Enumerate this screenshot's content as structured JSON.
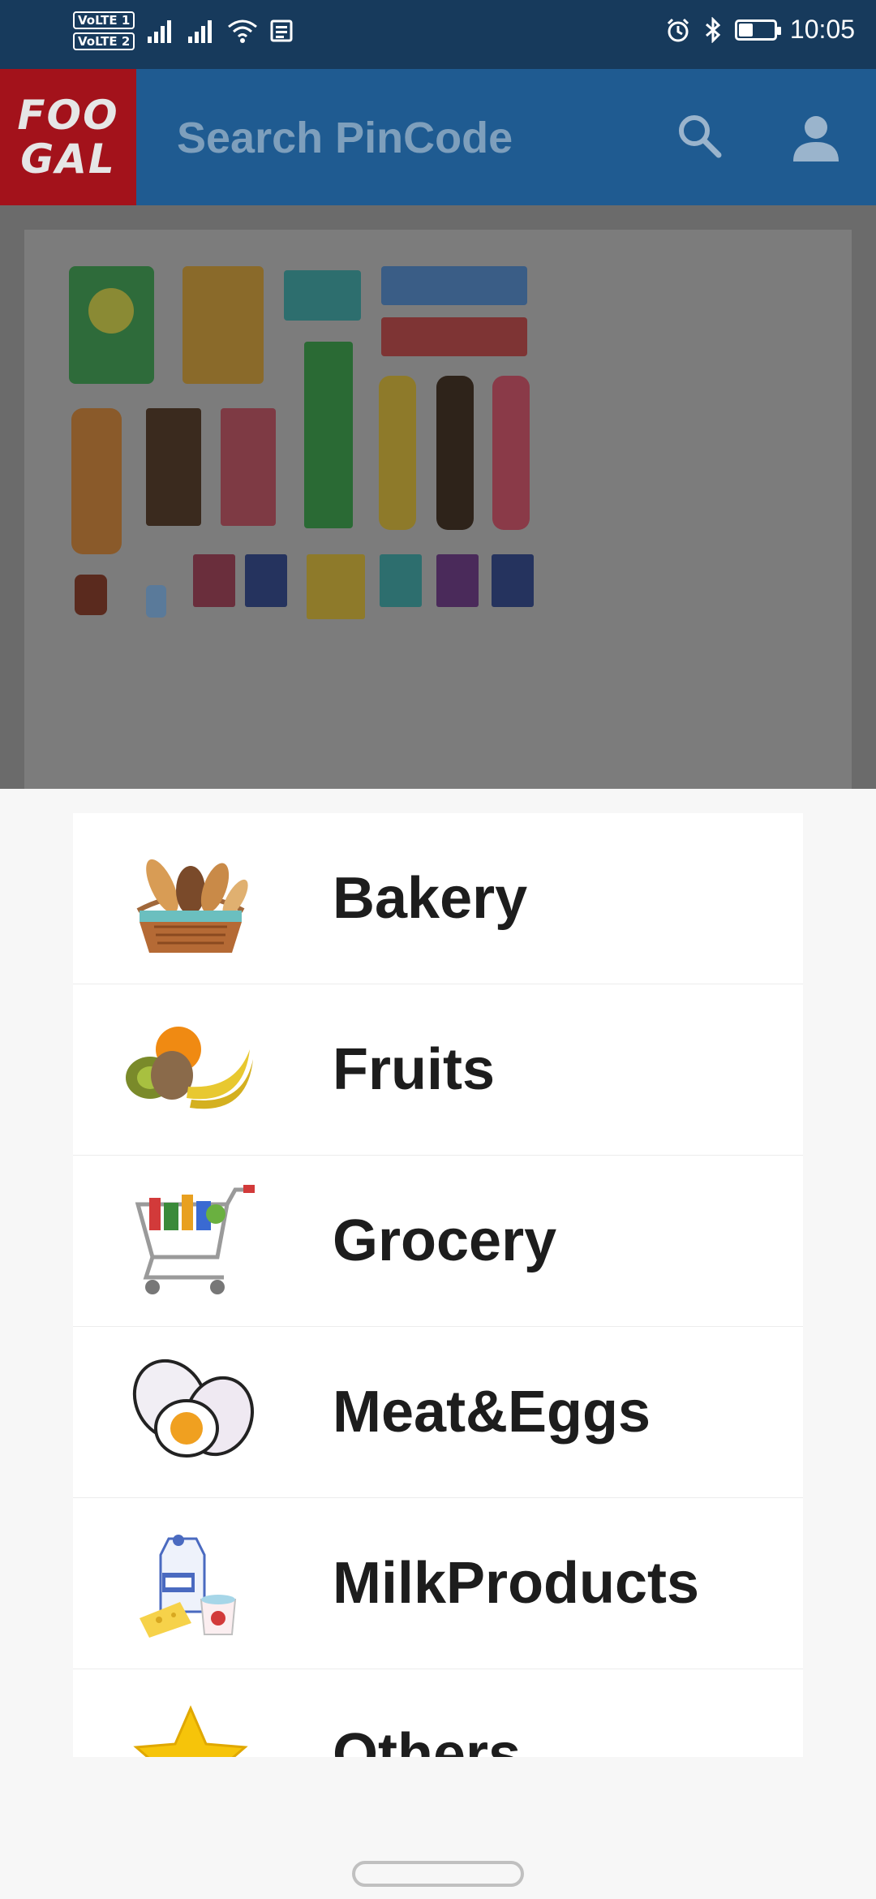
{
  "status_bar": {
    "sim1": "VoLTE 1",
    "sim2": "VoLTE 2",
    "time": "10:05",
    "battery_level": 0.4
  },
  "app_bar": {
    "logo_line1": "FOO",
    "logo_line2": "GAL",
    "search_placeholder": "Search  PinCode",
    "colors": {
      "bar": "#1f5b91",
      "logo_bg": "#a3121b"
    }
  },
  "categories": [
    {
      "label": "Bakery",
      "icon": "bread-basket-icon"
    },
    {
      "label": "Fruits",
      "icon": "fruits-icon"
    },
    {
      "label": "Grocery",
      "icon": "shopping-cart-icon"
    },
    {
      "label": "Meat&Eggs",
      "icon": "eggs-icon"
    },
    {
      "label": "MilkProducts",
      "icon": "milk-carton-icon"
    },
    {
      "label": "Others",
      "icon": "star-icon"
    }
  ]
}
